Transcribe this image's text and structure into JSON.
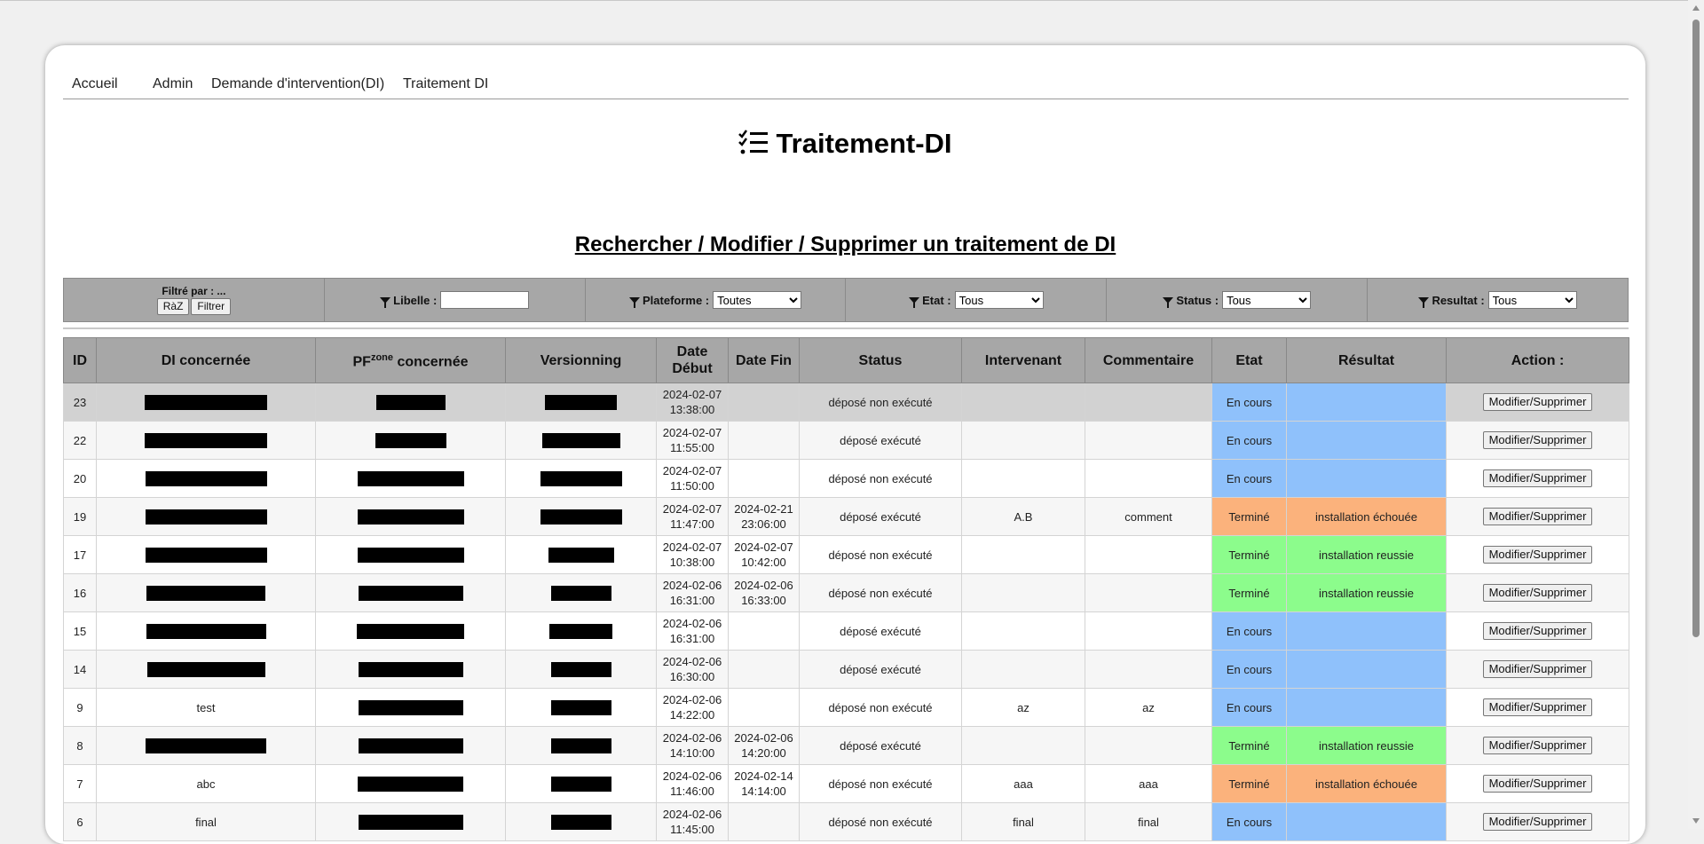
{
  "nav": [
    "Accueil",
    "Admin",
    "Demande d'intervention(DI)",
    "Traitement DI"
  ],
  "title": "Traitement-DI",
  "subtitle": "Rechercher / Modifier / Supprimer un traitement de DI",
  "filters": {
    "filtered_by": "Filtré par : ...",
    "reset_label": "RàZ",
    "filter_label": "Filtrer",
    "libelle_label": "Libelle :",
    "libelle_value": "",
    "plateforme_label": "Plateforme :",
    "plateforme_value": "Toutes",
    "etat_label": "Etat :",
    "etat_value": "Tous",
    "status_label": "Status :",
    "status_value": "Tous",
    "resultat_label": "Resultat :",
    "resultat_value": "Tous"
  },
  "columns": {
    "id": "ID",
    "di": "DI concernée",
    "pf_main": "PF",
    "pf_sup": "zone",
    "pf_rest": " concernée",
    "versionning": "Versionning",
    "date_debut": "Date Début",
    "date_fin": "Date Fin",
    "status": "Status",
    "intervenant": "Intervenant",
    "commentaire": "Commentaire",
    "etat": "Etat",
    "resultat": "Résultat",
    "action": "Action :"
  },
  "action_label": "Modifier/Supprimer",
  "colors": {
    "en_cours": "#8fc1fb",
    "termine_ok": "#8cfc8c",
    "termine_ko": "#fbb27c"
  },
  "rows": [
    {
      "id": "23",
      "di": "",
      "di_redacted": true,
      "debut": "2024-02-07 13:38:00",
      "fin": "",
      "status": "déposé non exécuté",
      "intervenant": "",
      "commentaire": "",
      "etat": "En cours",
      "resultat": "",
      "color": "blue"
    },
    {
      "id": "22",
      "di": "",
      "di_redacted": true,
      "debut": "2024-02-07 11:55:00",
      "fin": "",
      "status": "déposé exécuté",
      "intervenant": "",
      "commentaire": "",
      "etat": "En cours",
      "resultat": "",
      "color": "blue"
    },
    {
      "id": "20",
      "di": "",
      "di_redacted": true,
      "debut": "2024-02-07 11:50:00",
      "fin": "",
      "status": "déposé non exécuté",
      "intervenant": "",
      "commentaire": "",
      "etat": "En cours",
      "resultat": "",
      "color": "blue"
    },
    {
      "id": "19",
      "di": "",
      "di_redacted": true,
      "debut": "2024-02-07 11:47:00",
      "fin": "2024-02-21 23:06:00",
      "status": "déposé exécuté",
      "intervenant": "A.B",
      "commentaire": "comment",
      "etat": "Terminé",
      "resultat": "installation échouée",
      "color": "orange"
    },
    {
      "id": "17",
      "di": "",
      "di_redacted": true,
      "debut": "2024-02-07 10:38:00",
      "fin": "2024-02-07 10:42:00",
      "status": "déposé non exécuté",
      "intervenant": "",
      "commentaire": "",
      "etat": "Terminé",
      "resultat": "installation reussie",
      "color": "green"
    },
    {
      "id": "16",
      "di": "",
      "di_redacted": true,
      "debut": "2024-02-06 16:31:00",
      "fin": "2024-02-06 16:33:00",
      "status": "déposé non exécuté",
      "intervenant": "",
      "commentaire": "",
      "etat": "Terminé",
      "resultat": "installation reussie",
      "color": "green"
    },
    {
      "id": "15",
      "di": "",
      "di_redacted": true,
      "debut": "2024-02-06 16:31:00",
      "fin": "",
      "status": "déposé exécuté",
      "intervenant": "",
      "commentaire": "",
      "etat": "En cours",
      "resultat": "",
      "color": "blue"
    },
    {
      "id": "14",
      "di": "",
      "di_redacted": true,
      "debut": "2024-02-06 16:30:00",
      "fin": "",
      "status": "déposé exécuté",
      "intervenant": "",
      "commentaire": "",
      "etat": "En cours",
      "resultat": "",
      "color": "blue"
    },
    {
      "id": "9",
      "di": "test",
      "di_redacted": false,
      "debut": "2024-02-06 14:22:00",
      "fin": "",
      "status": "déposé non exécuté",
      "intervenant": "az",
      "commentaire": "az",
      "etat": "En cours",
      "resultat": "",
      "color": "blue"
    },
    {
      "id": "8",
      "di": "",
      "di_redacted": true,
      "debut": "2024-02-06 14:10:00",
      "fin": "2024-02-06 14:20:00",
      "status": "déposé exécuté",
      "intervenant": "",
      "commentaire": "",
      "etat": "Terminé",
      "resultat": "installation reussie",
      "color": "green"
    },
    {
      "id": "7",
      "di": "abc",
      "di_redacted": false,
      "debut": "2024-02-06 11:46:00",
      "fin": "2024-02-14 14:14:00",
      "status": "déposé non exécuté",
      "intervenant": "aaa",
      "commentaire": "aaa",
      "etat": "Terminé",
      "resultat": "installation échouée",
      "color": "orange"
    },
    {
      "id": "6",
      "di": "final",
      "di_redacted": false,
      "debut": "2024-02-06 11:45:00",
      "fin": "",
      "status": "déposé non exécuté",
      "intervenant": "final",
      "commentaire": "final",
      "etat": "En cours",
      "resultat": "",
      "color": "blue"
    }
  ]
}
